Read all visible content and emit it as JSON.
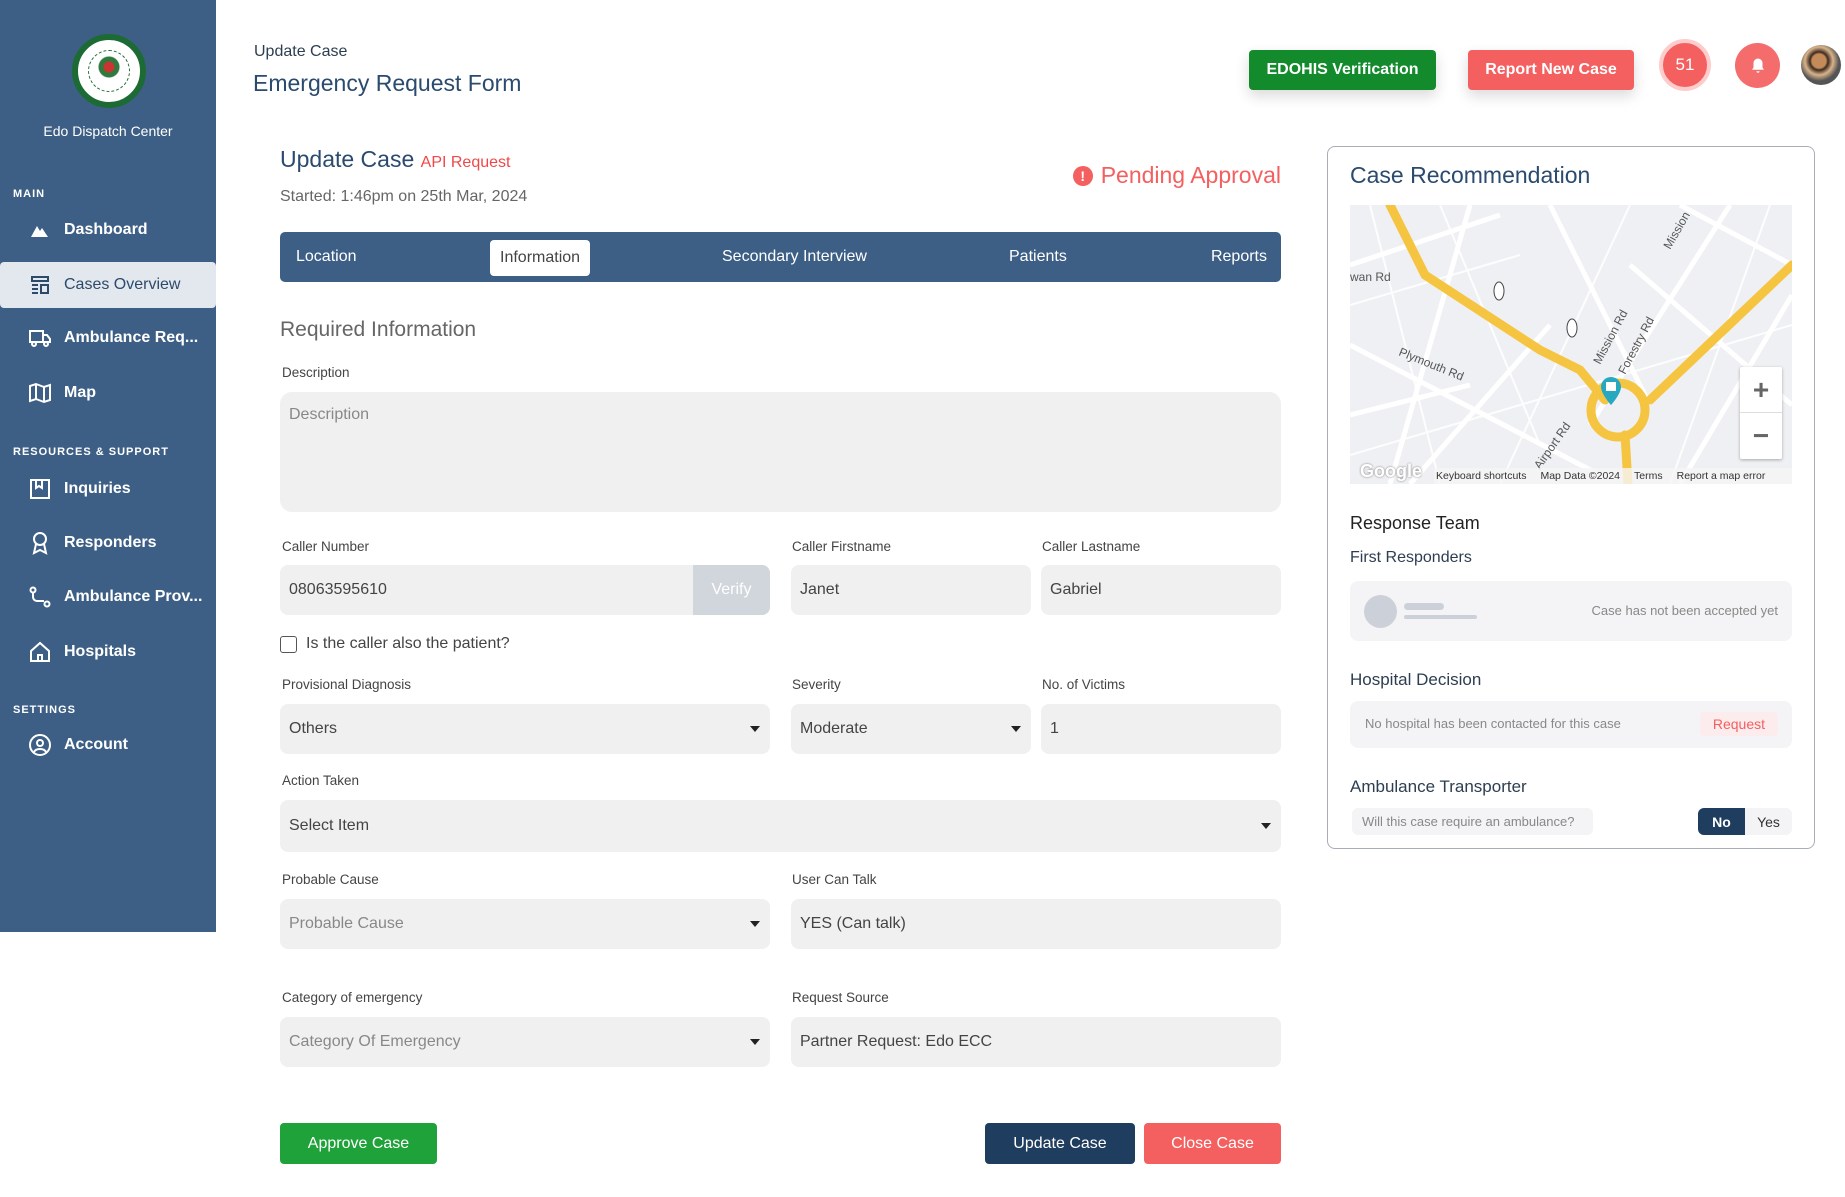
{
  "sidebar": {
    "brand": "Edo Dispatch Center",
    "logo_text": "EDO STATE GOVERNMENT NIGERIA",
    "sections": {
      "main": "MAIN",
      "resources": "RESOURCES & SUPPORT",
      "settings": "SETTINGS"
    },
    "items": [
      {
        "label": "Dashboard",
        "icon": "dashboard-icon"
      },
      {
        "label": "Cases Overview",
        "icon": "cases-icon",
        "active": true
      },
      {
        "label": "Ambulance Req...",
        "icon": "truck-icon"
      },
      {
        "label": "Map",
        "icon": "map-icon"
      },
      {
        "label": "Inquiries",
        "icon": "inquiries-icon"
      },
      {
        "label": "Responders",
        "icon": "responder-icon"
      },
      {
        "label": "Ambulance Prov...",
        "icon": "route-icon"
      },
      {
        "label": "Hospitals",
        "icon": "home-icon"
      },
      {
        "label": "Account",
        "icon": "user-circle-icon"
      }
    ]
  },
  "header": {
    "breadcrumb": "Update Case",
    "title": "Emergency Request Form",
    "edohis": "EDOHIS Verification",
    "report": "Report New Case",
    "count": "51"
  },
  "colors": {
    "sidebar": "#3d5f85",
    "green": "#138a2c",
    "red": "#f45f5f",
    "navy": "#1f3d5e"
  },
  "form": {
    "title": "Update Case",
    "tag": "API Request",
    "started": "Started: 1:46pm on 25th Mar, 2024",
    "status": "Pending Approval",
    "tabs": [
      "Location",
      "Information",
      "Secondary Interview",
      "Patients",
      "Reports"
    ],
    "active_tab": "Information",
    "section": "Required Information",
    "description": {
      "label": "Description",
      "placeholder": "Description"
    },
    "caller_number": {
      "label": "Caller Number",
      "value": "08063595610",
      "verify": "Verify"
    },
    "caller_first": {
      "label": "Caller Firstname",
      "value": "Janet"
    },
    "caller_last": {
      "label": "Caller Lastname",
      "value": "Gabriel"
    },
    "caller_patient": "Is the caller also the patient?",
    "diagnosis": {
      "label": "Provisional Diagnosis",
      "value": "Others"
    },
    "severity": {
      "label": "Severity",
      "value": "Moderate"
    },
    "victims": {
      "label": "No. of Victims",
      "value": "1"
    },
    "action": {
      "label": "Action Taken",
      "value": "Select Item"
    },
    "cause": {
      "label": "Probable Cause",
      "placeholder": "Probable Cause"
    },
    "talk": {
      "label": "User Can Talk",
      "value": "YES (Can talk)"
    },
    "category": {
      "label": "Category of emergency",
      "placeholder": "Category Of Emergency"
    },
    "source": {
      "label": "Request Source",
      "value": "Partner Request: Edo ECC"
    },
    "approve": "Approve Case",
    "update": "Update Case",
    "close": "Close Case"
  },
  "panel": {
    "title": "Case Recommendation",
    "map": {
      "roads": [
        "wan Rd",
        "Plymouth Rd",
        "Mission Rd",
        "Forestry Rd",
        "Airport Rd",
        "Mission"
      ],
      "google": "Google",
      "shortcuts": "Keyboard shortcuts",
      "mapdata": "Map Data ©2024",
      "terms": "Terms",
      "report": "Report a map error"
    },
    "response_team": "Response Team",
    "first_responders": "First Responders",
    "not_accepted": "Case has not been accepted yet",
    "hospital_decision": "Hospital Decision",
    "no_hospital": "No hospital has been contacted for this case",
    "request": "Request",
    "ambulance": "Ambulance Transporter",
    "ambulance_q": "Will this case require an ambulance?",
    "no": "No",
    "yes": "Yes",
    "selected": "No"
  }
}
